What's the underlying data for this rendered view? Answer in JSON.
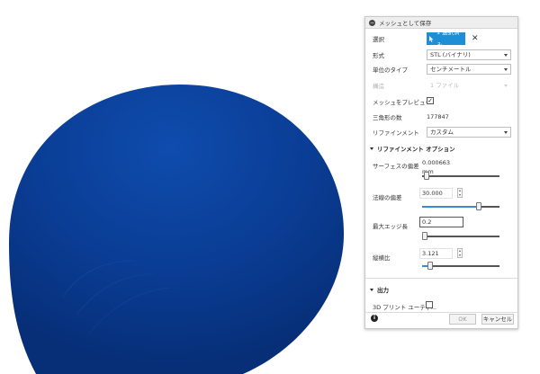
{
  "dialog": {
    "title": "メッシュとして保存",
    "rows": {
      "selection": {
        "label": "選択",
        "button": "1 選択済み",
        "clear": "✕"
      },
      "format": {
        "label": "形式",
        "value": "STL (バイナリ)"
      },
      "unit": {
        "label": "単位のタイプ",
        "value": "センチメートル"
      },
      "structure": {
        "label": "構造",
        "value": "1 ファイル"
      },
      "preview": {
        "label": "メッシュをプレビュー",
        "checked": true,
        "mark": "✓"
      },
      "triangles": {
        "label": "三角形の数",
        "value": "177847"
      },
      "refinement": {
        "label": "リファインメント",
        "value": "カスタム"
      }
    },
    "refinement_options": {
      "header": "リファインメント オプション",
      "surface_deviation": {
        "label": "サーフェスの偏差",
        "value": "0.000663 mm",
        "slider_level": 0.02
      },
      "normal_deviation": {
        "label": "法線の偏差",
        "value": "30.000",
        "slider_level": 0.75
      },
      "max_edge": {
        "label": "最大エッジ長",
        "value": "0.2",
        "slider_level": 0.0
      },
      "aspect_ratio": {
        "label": "縦横比",
        "value": "3.121",
        "slider_level": 0.08
      }
    },
    "output": {
      "header": "出力",
      "print_utility": {
        "label": "3D プリント ユーティ...",
        "checked": false
      }
    },
    "footer": {
      "ok": "OK",
      "cancel": "キャンセル",
      "info": "i"
    }
  },
  "colors": {
    "mesh": "#0b3c8f",
    "accent": "#1e8fd6"
  }
}
